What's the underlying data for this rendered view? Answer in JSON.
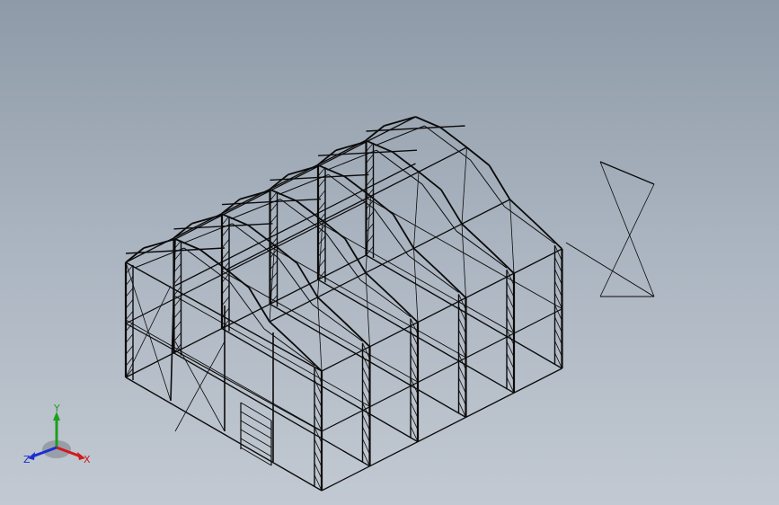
{
  "view": {
    "background_top": "#8f9aa8",
    "background_bottom": "#c2c9d2",
    "line_color": "#0b0b0b"
  },
  "model": {
    "description_type": "steel-frame tent hall, isometric wireframe",
    "bays": 5,
    "portal_frames": 6
  },
  "triad": {
    "x_label": "X",
    "y_label": "Y",
    "z_label": "Z",
    "x_color": "#d11a1a",
    "y_color": "#1ca01c",
    "z_color": "#1a2fd1"
  }
}
